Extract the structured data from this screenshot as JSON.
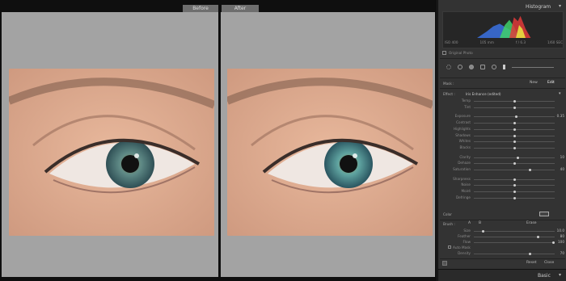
{
  "view": {
    "before_label": "Before",
    "after_label": "After"
  },
  "histogram": {
    "title": "Histogram",
    "stats": [
      "ISO 400",
      "105 mm",
      "f / 6.3",
      "1/60 SEC"
    ],
    "original_photo_label": "Original Photo"
  },
  "mask": {
    "label": "Mask :",
    "new": "New",
    "edit": "Edit"
  },
  "effect": {
    "label": "Effect :",
    "value": "Iris Enhance (edited)"
  },
  "sliders": [
    {
      "name": "Temp",
      "value": "",
      "pos": 0.5
    },
    {
      "name": "Tint",
      "value": "",
      "pos": 0.5
    },
    {
      "name": "Exposure",
      "value": "0.35",
      "pos": 0.53
    },
    {
      "name": "Contrast",
      "value": "",
      "pos": 0.5
    },
    {
      "name": "Highlights",
      "value": "",
      "pos": 0.5
    },
    {
      "name": "Shadows",
      "value": "",
      "pos": 0.5
    },
    {
      "name": "Whites",
      "value": "",
      "pos": 0.5
    },
    {
      "name": "Blacks",
      "value": "",
      "pos": 0.5
    },
    {
      "name": "Clarity",
      "value": "10",
      "pos": 0.55
    },
    {
      "name": "Dehaze",
      "value": "",
      "pos": 0.5
    },
    {
      "name": "Saturation",
      "value": "40",
      "pos": 0.7
    },
    {
      "name": "Sharpness",
      "value": "",
      "pos": 0.5
    },
    {
      "name": "Noise",
      "value": "",
      "pos": 0.5
    },
    {
      "name": "Moiré",
      "value": "",
      "pos": 0.5
    },
    {
      "name": "Defringe",
      "value": "",
      "pos": 0.5
    }
  ],
  "color_label": "Color",
  "brush": {
    "label": "Brush :",
    "a": "A",
    "b": "B",
    "erase": "Erase",
    "size_label": "Size",
    "size_value": "10.0",
    "size_pos": 0.1,
    "feather_label": "Feather",
    "feather_value": "80",
    "feather_pos": 0.8,
    "flow_label": "Flow",
    "flow_value": "100",
    "flow_pos": 1.0,
    "automask_label": "Auto Mask",
    "density_label": "Density",
    "density_value": "70",
    "density_pos": 0.7
  },
  "footer": {
    "reset": "Reset",
    "close": "Close"
  },
  "basic_label": "Basic"
}
